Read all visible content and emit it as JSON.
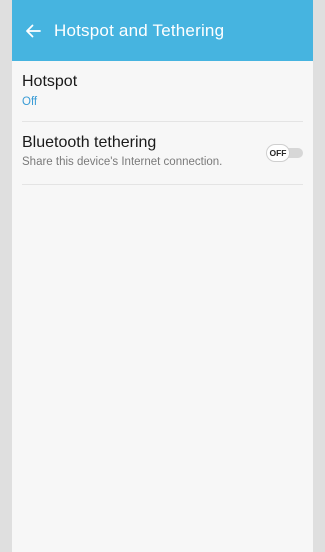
{
  "header": {
    "title": "Hotspot and Tethering",
    "back_icon": "arrow-left-icon",
    "background": "#46b4e0"
  },
  "items": [
    {
      "title": "Hotspot",
      "subtitle": "Off"
    },
    {
      "title": "Bluetooth tethering",
      "subtitle": "Share this device's Internet connection.",
      "toggle_label": "OFF"
    }
  ],
  "colors": {
    "accent": "#3a9cd6",
    "background": "#f7f7f7"
  }
}
